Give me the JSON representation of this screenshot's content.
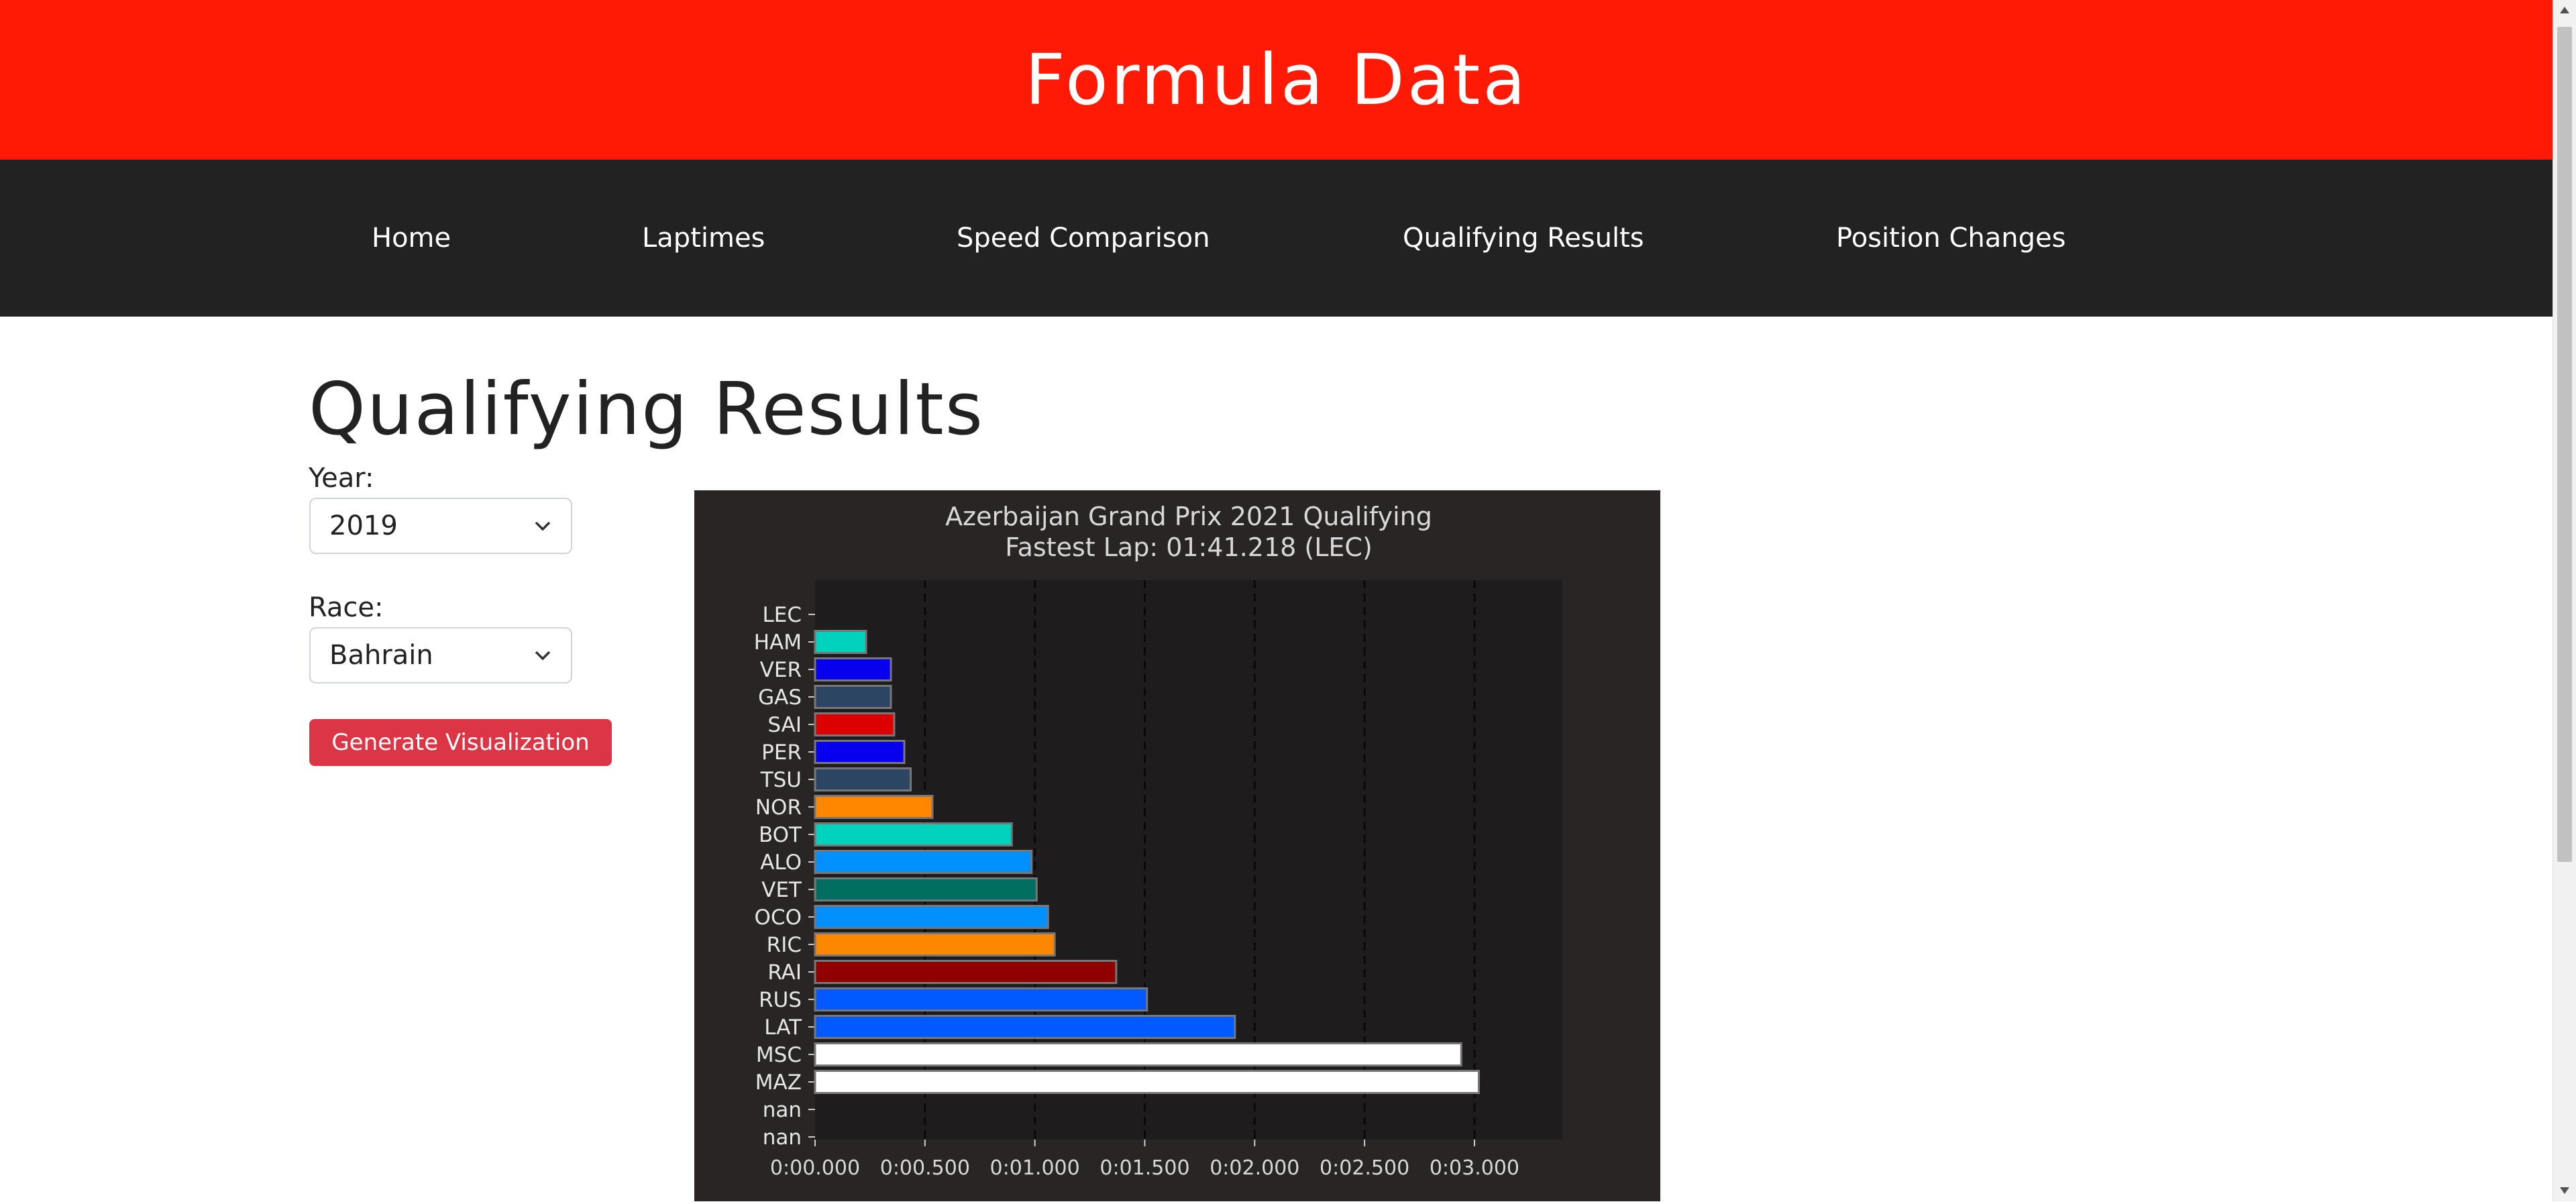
{
  "header": {
    "title": "Formula Data"
  },
  "nav": {
    "items": [
      {
        "label": "Home"
      },
      {
        "label": "Laptimes"
      },
      {
        "label": "Speed Comparison"
      },
      {
        "label": "Qualifying Results"
      },
      {
        "label": "Position Changes"
      }
    ]
  },
  "main": {
    "title": "Qualifying Results",
    "year": {
      "label": "Year:",
      "value": "2019"
    },
    "race": {
      "label": "Race:",
      "value": "Bahrain"
    },
    "generate_label": "Generate Visualization"
  },
  "icons": {
    "select_chevron": "chevron-down-icon",
    "scroll_up": "scroll-up-arrow-icon",
    "scroll_down": "scroll-down-arrow-icon"
  },
  "colors": {
    "header_bg": "#ff1a05",
    "nav_bg": "#222222",
    "button_bg": "#dc3545",
    "chart_bg": "#2a2525",
    "plot_bg": "#1e1c1c"
  },
  "chart_data": {
    "type": "bar",
    "orientation": "horizontal",
    "title": "Azerbaijan Grand Prix 2021 Qualifying\nFastest Lap: 01:41.218 (LEC)",
    "xlabel": "",
    "ylabel": "",
    "xlim": [
      0,
      3.4
    ],
    "x_ticks": [
      "0:00.000",
      "0:00.500",
      "0:01.000",
      "0:01.500",
      "0:02.000",
      "0:02.500",
      "0:03.000"
    ],
    "x_tick_values": [
      0,
      0.5,
      1.0,
      1.5,
      2.0,
      2.5,
      3.0
    ],
    "grid": "vertical dashed",
    "categories": [
      "LEC",
      "HAM",
      "VER",
      "GAS",
      "SAI",
      "PER",
      "TSU",
      "NOR",
      "BOT",
      "ALO",
      "VET",
      "OCO",
      "RIC",
      "RAI",
      "RUS",
      "LAT",
      "MSC",
      "MAZ",
      "nan",
      "nan"
    ],
    "values": [
      0,
      0.232,
      0.345,
      0.345,
      0.36,
      0.406,
      0.435,
      0.534,
      0.895,
      0.985,
      1.008,
      1.06,
      1.09,
      1.37,
      1.51,
      1.91,
      2.94,
      3.02,
      null,
      null
    ],
    "colors": [
      "#00d2be",
      "#00d2be",
      "#0600ef",
      "#2b4562",
      "#dc0000",
      "#0600ef",
      "#2b4562",
      "#ff8700",
      "#00d2be",
      "#0090ff",
      "#006f62",
      "#0090ff",
      "#ff8700",
      "#900000",
      "#005aff",
      "#005aff",
      "#ffffff",
      "#ffffff",
      "#ffffff",
      "#ffffff"
    ]
  }
}
